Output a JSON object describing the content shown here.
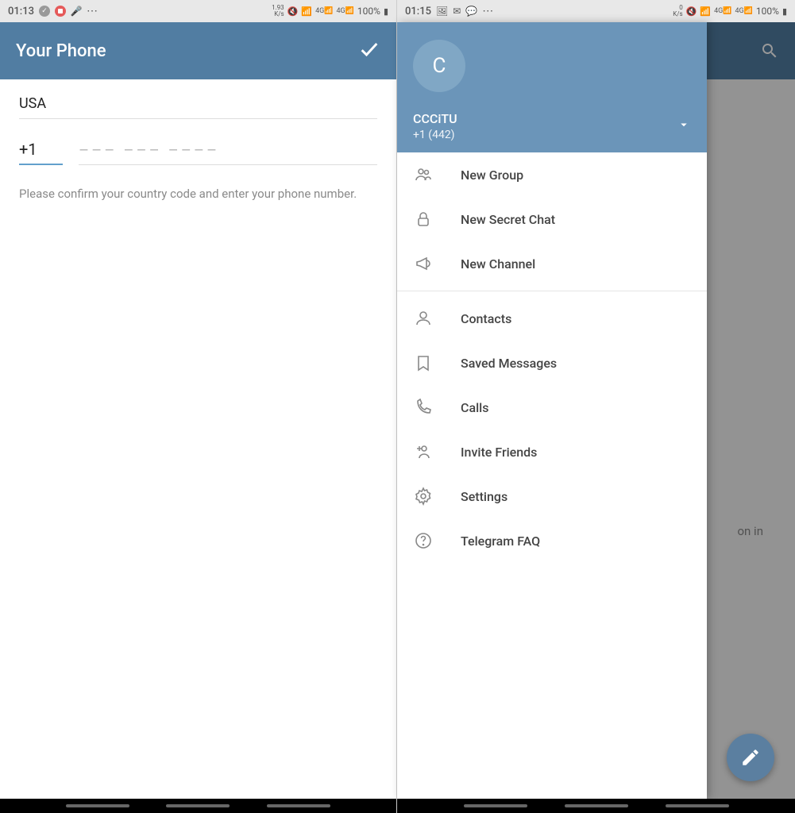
{
  "left": {
    "status": {
      "time": "01:13",
      "speed": "1.93\nK/s",
      "battery": "100%"
    },
    "appbar": {
      "title": "Your Phone"
    },
    "form": {
      "country": "USA",
      "code": "+1",
      "placeholder": "––– ––– ––––",
      "hint": "Please confirm your country code and enter your phone number."
    }
  },
  "right": {
    "status": {
      "time": "01:15",
      "speed": "0\nK/s",
      "battery": "100%"
    },
    "bg_text": "on in",
    "drawer": {
      "avatar_initial": "C",
      "name": "CCCiTU",
      "phone": "+1 (442)",
      "menu1": [
        {
          "icon": "group",
          "label": "New Group"
        },
        {
          "icon": "lock",
          "label": "New Secret Chat"
        },
        {
          "icon": "megaphone",
          "label": "New Channel"
        }
      ],
      "menu2": [
        {
          "icon": "contact",
          "label": "Contacts"
        },
        {
          "icon": "bookmark",
          "label": "Saved Messages"
        },
        {
          "icon": "phone",
          "label": "Calls"
        },
        {
          "icon": "invite",
          "label": "Invite Friends"
        },
        {
          "icon": "gear",
          "label": "Settings"
        },
        {
          "icon": "help",
          "label": "Telegram FAQ"
        }
      ]
    }
  }
}
